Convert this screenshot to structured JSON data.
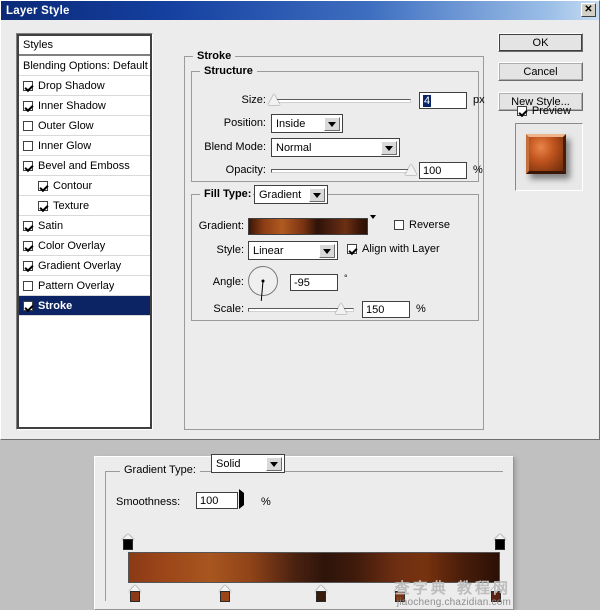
{
  "window": {
    "title": "Layer Style",
    "close_label": "✕"
  },
  "styles_list": {
    "header": "Styles",
    "blending_options": "Blending Options: Default",
    "items": [
      {
        "label": "Drop Shadow",
        "checked": true,
        "sub": false,
        "selected": false
      },
      {
        "label": "Inner Shadow",
        "checked": true,
        "sub": false,
        "selected": false
      },
      {
        "label": "Outer Glow",
        "checked": false,
        "sub": false,
        "selected": false
      },
      {
        "label": "Inner Glow",
        "checked": false,
        "sub": false,
        "selected": false
      },
      {
        "label": "Bevel and Emboss",
        "checked": true,
        "sub": false,
        "selected": false
      },
      {
        "label": "Contour",
        "checked": true,
        "sub": true,
        "selected": false
      },
      {
        "label": "Texture",
        "checked": true,
        "sub": true,
        "selected": false
      },
      {
        "label": "Satin",
        "checked": true,
        "sub": false,
        "selected": false
      },
      {
        "label": "Color Overlay",
        "checked": true,
        "sub": false,
        "selected": false
      },
      {
        "label": "Gradient Overlay",
        "checked": true,
        "sub": false,
        "selected": false
      },
      {
        "label": "Pattern Overlay",
        "checked": false,
        "sub": false,
        "selected": false
      },
      {
        "label": "Stroke",
        "checked": true,
        "sub": false,
        "selected": true
      }
    ]
  },
  "buttons": {
    "ok": "OK",
    "cancel": "Cancel",
    "new_style": "New Style...",
    "preview": "Preview",
    "preview_checked": true
  },
  "stroke": {
    "group_title": "Stroke",
    "structure": {
      "group_title": "Structure",
      "size_label": "Size:",
      "size_value": "4",
      "size_unit": "px",
      "size_slider_pct": 2,
      "position_label": "Position:",
      "position_value": "Inside",
      "blend_mode_label": "Blend Mode:",
      "blend_mode_value": "Normal",
      "opacity_label": "Opacity:",
      "opacity_value": "100",
      "opacity_unit": "%",
      "opacity_slider_pct": 100
    },
    "fill": {
      "fill_type_label": "Fill Type:",
      "fill_type_value": "Gradient",
      "gradient_label": "Gradient:",
      "reverse_label": "Reverse",
      "reverse_checked": false,
      "style_label": "Style:",
      "style_value": "Linear",
      "align_label": "Align with Layer",
      "align_checked": true,
      "angle_label": "Angle:",
      "angle_value": "-95",
      "angle_unit": "°",
      "scale_label": "Scale:",
      "scale_value": "150",
      "scale_unit": "%",
      "scale_slider_pct": 88
    }
  },
  "gradient_editor": {
    "type_label": "Gradient Type:",
    "type_value": "Solid",
    "smoothness_label": "Smoothness:",
    "smoothness_value": "100",
    "smoothness_unit": "%",
    "opacity_stops": [
      {
        "pos_pct": 0,
        "opacity": 100
      },
      {
        "pos_pct": 100,
        "opacity": 100
      }
    ],
    "color_stops": [
      {
        "pos_pct": 2,
        "color": "#8a3a16"
      },
      {
        "pos_pct": 26,
        "color": "#9c4519"
      },
      {
        "pos_pct": 52,
        "color": "#3a1a0c"
      },
      {
        "pos_pct": 73,
        "color": "#7a3312"
      },
      {
        "pos_pct": 99,
        "color": "#5a2410"
      }
    ]
  },
  "watermark": {
    "cn": "查字典 教程网",
    "en": "jiaocheng.chazidian.com"
  }
}
